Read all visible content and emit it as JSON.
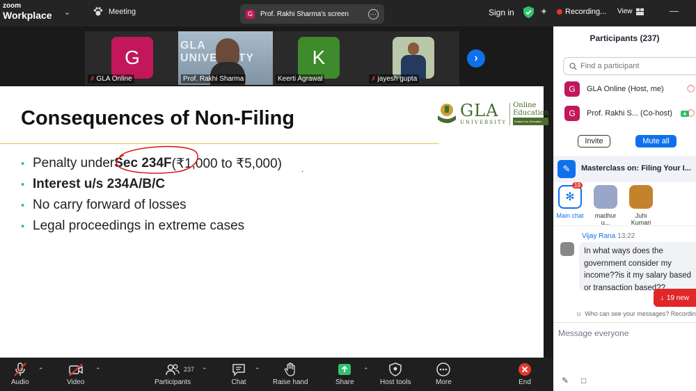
{
  "topbar": {
    "brand_top": "zoom",
    "brand_bottom": "Workplace",
    "meeting_label": "Meeting",
    "share_tab_letter": "G",
    "share_tab_label": "Prof. Rakhi Sharma's screen",
    "signin_label": "Sign in",
    "recording_label": "Recording...",
    "view_label": "View"
  },
  "thumbs": [
    {
      "name": "GLA Online",
      "letter": "G",
      "color": "#c2185b",
      "muted": true
    },
    {
      "name": "Prof. Rakhi Sharma",
      "letter": "",
      "color": "",
      "muted": false,
      "bg_text": "GLA UNIVERSITY"
    },
    {
      "name": "Keerti Agrawal",
      "letter": "K",
      "color": "#3f8a2c",
      "muted": false
    },
    {
      "name": "jayesh gupta",
      "letter": "",
      "color": "",
      "muted": true
    }
  ],
  "slide": {
    "title": "Consequences of Non-Filing",
    "logo_main": "GLA",
    "logo_sub": "UNIVERSITY",
    "logo_online": "Online",
    "logo_education": "Education",
    "logo_tagline": "Enabled for Education",
    "b1_pre": "Penalty under ",
    "b1_bold": "Sec 234F",
    "b1_post": " (₹1,000 to ₹5,000)",
    "b2": "Interest u/s 234A/B/C",
    "b3": "No carry forward of losses",
    "b4": "Legal proceedings in extreme cases",
    "stray_mark": "."
  },
  "toolbar": {
    "audio": "Audio",
    "video": "Video",
    "participants": "Participants",
    "participants_count": "237",
    "chat": "Chat",
    "raise_hand": "Raise hand",
    "share": "Share",
    "host_tools": "Host tools",
    "more": "More",
    "end": "End"
  },
  "panel": {
    "title": "Participants (237)",
    "search_placeholder": "Find a participant",
    "p1_letter": "G",
    "p1_name": "GLA Online (Host, me)",
    "p2_letter": "G",
    "p2_name": "Prof. Rakhi S... (Co-host)",
    "invite": "Invite",
    "mute_all": "Mute all",
    "chat_title": "Masterclass on: Filing Your I...",
    "main_chat": "Main chat",
    "main_chat_badge": "19",
    "chan2": "madhur u...",
    "chan3": "Juhi Kumari",
    "msg_name": "Vijay Rana",
    "msg_time": "13:22",
    "msg_text": "In what ways does the government consider my income??is it my salary based or transaction based??",
    "new_msgs": "19 new",
    "who_can_see": "Who can see your messages? Recording",
    "message_placeholder": "Message everyone"
  }
}
